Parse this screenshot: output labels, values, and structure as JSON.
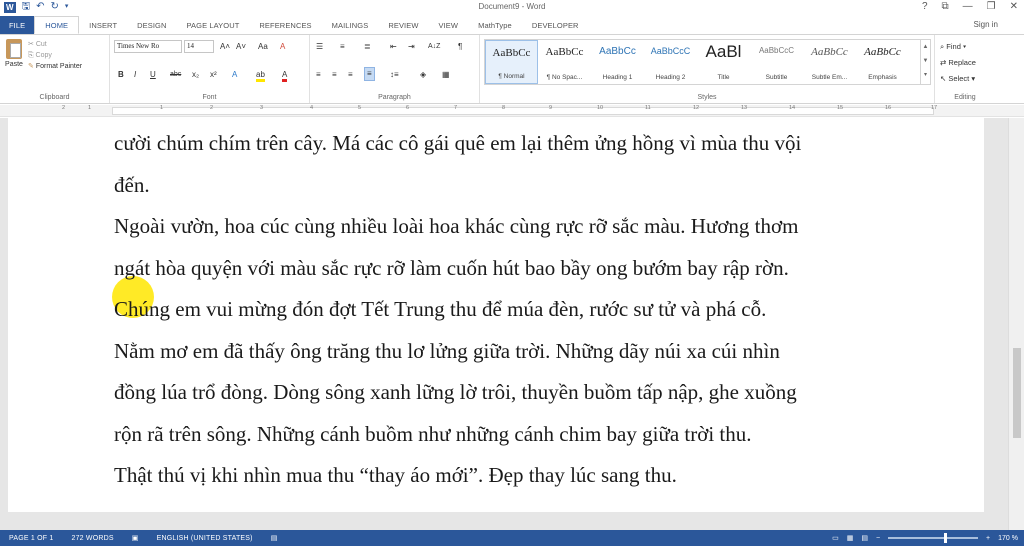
{
  "window": {
    "title": "Document9 - Word",
    "controls": [
      "?",
      "⧉",
      "—",
      "❐",
      "✕"
    ],
    "signin": "Sign in"
  },
  "qat": {
    "icons": [
      "word-icon",
      "save-icon",
      "undo-icon",
      "redo-icon",
      "customize-icon"
    ]
  },
  "tabs": [
    "FILE",
    "HOME",
    "INSERT",
    "DESIGN",
    "PAGE LAYOUT",
    "REFERENCES",
    "MAILINGS",
    "REVIEW",
    "VIEW",
    "MathType",
    "DEVELOPER"
  ],
  "ribbon": {
    "clipboard": {
      "label": "Clipboard",
      "paste": "Paste",
      "cut": "Cut",
      "copy": "Copy",
      "format_painter": "Format Painter"
    },
    "font": {
      "label": "Font",
      "name": "Times New Ro",
      "size": "14",
      "grow": "A˄",
      "shrink": "A˅",
      "case": "Aa",
      "clear": "A",
      "bold": "B",
      "italic": "I",
      "underline": "U",
      "strike": "abc",
      "sub": "x₂",
      "sup": "x²",
      "effects": "A",
      "highlight": "ab",
      "color": "A"
    },
    "paragraph": {
      "label": "Paragraph",
      "bullets": "☰",
      "numbering": "≡",
      "multilevel": "≣",
      "decrease": "⇤",
      "increase": "⇥",
      "sort": "A↓Z",
      "show": "¶"
    },
    "styles": {
      "label": "Styles",
      "items": [
        {
          "sample": "AaBbCc",
          "name": "¶ Normal"
        },
        {
          "sample": "AaBbCc",
          "name": "¶ No Spac..."
        },
        {
          "sample": "AaBbCc",
          "name": "Heading 1"
        },
        {
          "sample": "AaBbCcC",
          "name": "Heading 2"
        },
        {
          "sample": "AaBl",
          "name": "Title"
        },
        {
          "sample": "AaBbCcC",
          "name": "Subtitle"
        },
        {
          "sample": "AaBbCc",
          "name": "Subtle Em..."
        },
        {
          "sample": "AaBbCc",
          "name": "Emphasis"
        }
      ]
    },
    "editing": {
      "label": "Editing",
      "find": "Find",
      "replace": "Replace",
      "select": "Select"
    }
  },
  "ruler": {
    "numbers": [
      "2",
      "1",
      "1",
      "2",
      "3",
      "4",
      "5",
      "6",
      "7",
      "8",
      "9",
      "10",
      "11",
      "12",
      "13",
      "14",
      "15",
      "16",
      "17"
    ]
  },
  "document": {
    "lines": [
      "cười chúm chím trên cây. Má các cô gái quê em lại thêm ửng hồng vì mùa thu vội",
      "đến.",
      "Ngoài vườn, hoa cúc cùng nhiều loài hoa khác cùng rực rỡ sắc màu. Hương thơm",
      "ngát hòa quyện với màu sắc rực rỡ làm cuốn hút bao bầy ong bướm bay rập rờn.",
      "Chúng em vui mừng đón đợt Tết Trung thu để múa đèn, rước sư tử và phá cỗ.",
      "Nằm mơ em đã thấy ông trăng thu lơ lửng giữa trời. Những dãy núi xa cúi nhìn",
      "đồng lúa trổ đòng. Dòng sông xanh lững lờ trôi, thuyền buồm tấp nập, ghe xuồng",
      "rộn rã trên sông. Những cánh buồm như những cánh chim bay giữa trời thu.",
      "Thật thú vị khi nhìn mua thu “thay áo mới”. Đẹp thay lúc sang thu."
    ]
  },
  "status": {
    "page": "PAGE 1 OF 1",
    "words": "272 WORDS",
    "language": "ENGLISH (UNITED STATES)",
    "zoom": "170 %",
    "zoom_level": 1.7
  },
  "colors": {
    "accent": "#2b579a",
    "highlight": "#ffe600"
  }
}
